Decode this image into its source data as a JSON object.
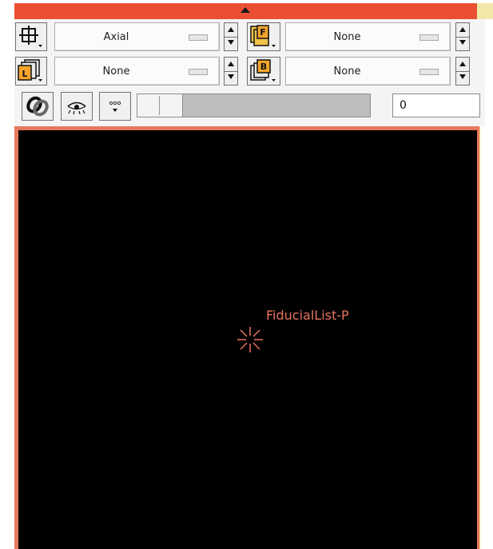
{
  "view_color": "#ea4f33",
  "row1": {
    "orientation_value": "Axial",
    "foreground_value": "None",
    "layer_icon": "crosshair-layout-icon",
    "foreground_icon": "foreground-layer-F-icon"
  },
  "row2": {
    "label_value": "None",
    "background_value": "None",
    "label_icon": "label-layer-L-icon",
    "background_icon": "background-layer-B-icon"
  },
  "row3": {
    "link_icon": "link-icon",
    "visibility_icon": "eye-visibility-icon",
    "more_icon": "dots-menu-icon",
    "slice_value": "0"
  },
  "viewer": {
    "background": "#000000",
    "fiducial_label": "FiducialList-P",
    "fiducial_color": "#e8735f"
  }
}
